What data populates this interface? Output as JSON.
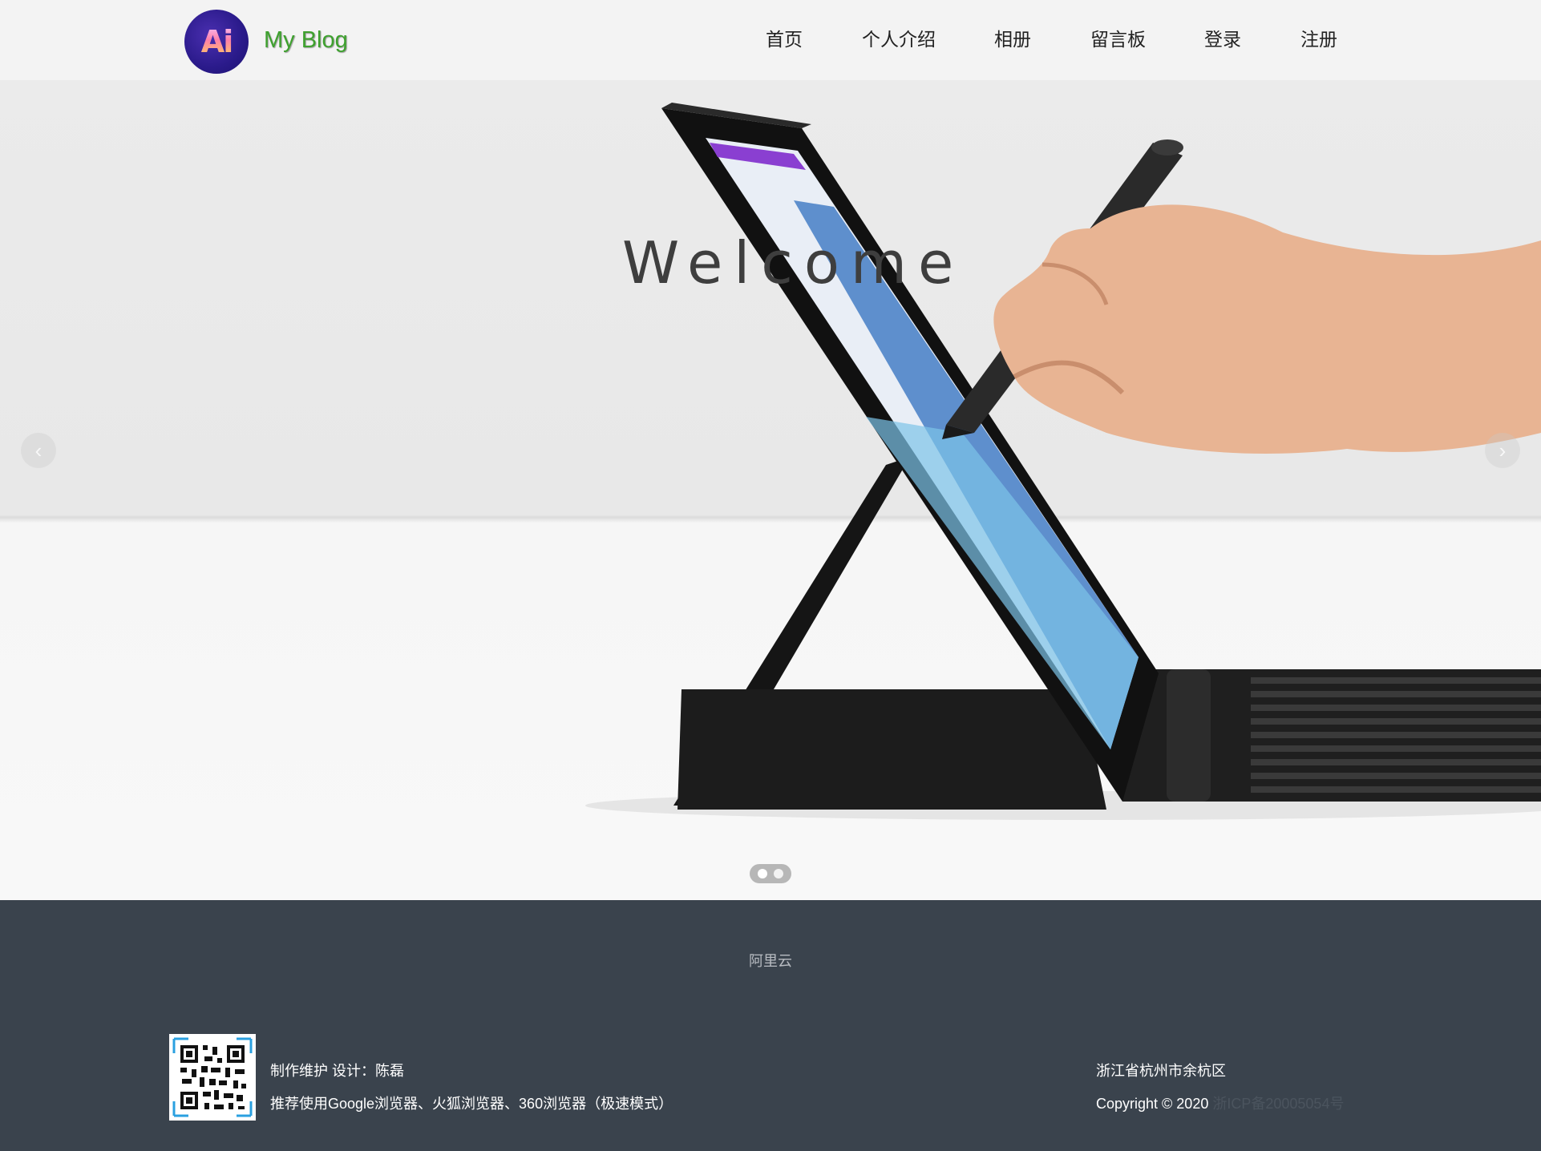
{
  "header": {
    "logo_text": "Ai",
    "brand": "My Blog",
    "nav": [
      {
        "label": "首页"
      },
      {
        "label": "个人介绍"
      },
      {
        "label": "相册"
      },
      {
        "label": "留言板"
      },
      {
        "label": "登录"
      },
      {
        "label": "注册"
      }
    ]
  },
  "hero": {
    "welcome": "Welcome",
    "prev_icon": "chevron-left-icon",
    "next_icon": "chevron-right-icon",
    "slide_count": 2,
    "active_slide": 1
  },
  "footer": {
    "friend_link": "阿里云",
    "maintainer": "制作维护 设计：陈磊",
    "browser_tip": "推荐使用Google浏览器、火狐浏览器、360浏览器（极速模式）",
    "address": "浙江省杭州市余杭区",
    "copyright": "Copyright © 2020",
    "icp": "浙ICP备20005054号"
  },
  "colors": {
    "brand": "#3ea12e",
    "footer_bg": "#3a434d",
    "header_bg": "#f3f3f3"
  }
}
